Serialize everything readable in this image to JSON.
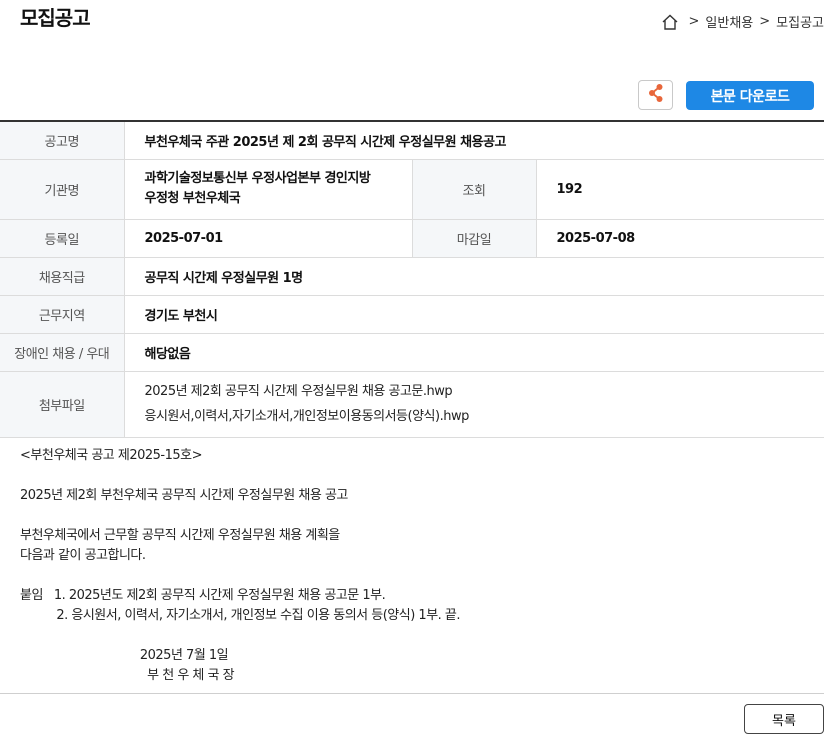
{
  "header": {
    "title": "모집공고",
    "breadcrumb": [
      ">",
      "일반채용",
      ">",
      "모집공고"
    ]
  },
  "toolbar": {
    "share_icon": "share-icon",
    "download_label": "본문 다운로드"
  },
  "info": {
    "title_label": "공고명",
    "title_value": "부천우체국 주관 2025년 제 2회 공무직 시간제 우정실무원 채용공고",
    "org_label": "기관명",
    "org_value_line1": "과학기술정보통신부 우정사업본부 경인지방",
    "org_value_line2": "우정청 부천우체국",
    "views_label": "조회",
    "views_value": "192",
    "reg_label": "등록일",
    "reg_value": "2025-07-01",
    "deadline_label": "마감일",
    "deadline_value": "2025-07-08",
    "position_label": "채용직급",
    "position_value": "공무직 시간제 우정실무원 1명",
    "region_label": "근무지역",
    "region_value": "경기도 부천시",
    "disability_label": "장애인 채용 / 우대",
    "disability_value": "해당없음",
    "files_label": "첨부파일",
    "files": [
      "2025년 제2회 공무직 시간제 우정실무원 채용 공고문.hwp",
      "응시원서,이력서,자기소개서,개인정보이용동의서등(양식).hwp"
    ]
  },
  "body": {
    "text": "<부천우체국 공고 제2025-15호>\n\n2025년 제2회 부천우체국 공무직 시간제 우정실무원 채용 공고\n\n부천우체국에서 근무할 공무직 시간제 우정실무원 채용 계획을\n다음과 같이 공고합니다.\n\n붙임   1. 2025년도 제2회 공무직 시간제 우정실무원 채용 공고문 1부.\n          2. 응시원서, 이력서, 자기소개서, 개인정보 수집 이용 동의서 등(양식) 1부. 끝.\n\n                                 2025년 7월 1일\n                                   부 천 우 체 국 장"
  },
  "footer": {
    "list_label": "목록"
  }
}
